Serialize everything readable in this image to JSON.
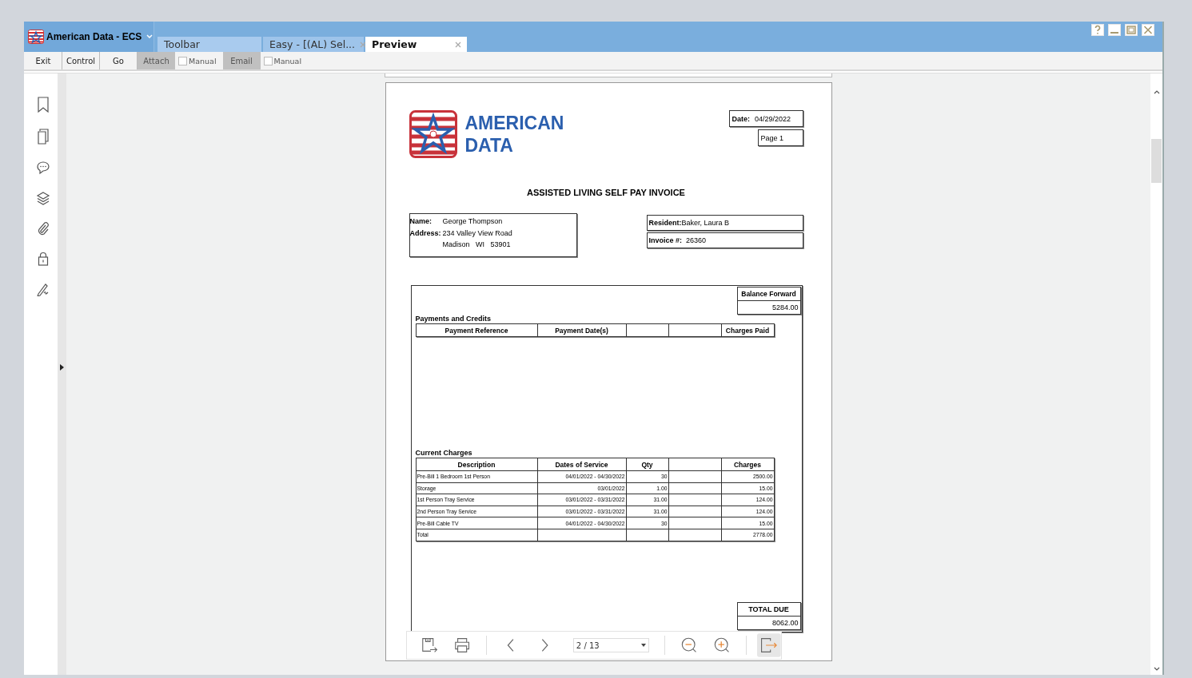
{
  "app": {
    "title": "American Data - ECS"
  },
  "tabs": [
    {
      "label": "Toolbar",
      "selected": false,
      "closable": false
    },
    {
      "label": "Easy - [(AL) Sel...",
      "selected": false,
      "closable": true
    },
    {
      "label": "Preview",
      "selected": true,
      "closable": true
    }
  ],
  "toolbar": [
    {
      "kind": "button",
      "label": "Exit",
      "disabled": false
    },
    {
      "kind": "button",
      "label": "Control",
      "disabled": false
    },
    {
      "kind": "button",
      "label": "Go",
      "disabled": false
    },
    {
      "kind": "button",
      "label": "Attach",
      "disabled": true
    },
    {
      "kind": "checkbox",
      "label": "Manual",
      "checked": false
    },
    {
      "kind": "button",
      "label": "Email",
      "disabled": true
    },
    {
      "kind": "checkbox",
      "label": "Manual",
      "checked": false
    }
  ],
  "invoice": {
    "logo_lines": [
      "AMERICAN",
      "DATA"
    ],
    "date_label": "Date:",
    "date": "04/29/2022",
    "page": "Page 1",
    "title": "ASSISTED LIVING SELF PAY INVOICE",
    "name_label": "Name:",
    "name": "George Thompson",
    "address_label": "Address:",
    "address_lines": [
      "234 Valley View Road",
      "Madison   WI   53901"
    ],
    "resident_label": "Resident:",
    "resident": "Baker, Laura B",
    "invoice_label": "Invoice #:",
    "invoice_number": "26360",
    "balance_label": "Balance Forward",
    "balance": "5284.00",
    "payments_title": "Payments and Credits",
    "payments_columns": [
      {
        "label": "Payment Reference"
      },
      {
        "label": "Payment Date(s)"
      },
      {},
      {},
      {
        "label": "Charges Paid"
      }
    ],
    "charges_title": "Current Charges",
    "charges_columns": [
      {
        "label": "Description"
      },
      {
        "label": "Dates of Service"
      },
      {
        "label": "Qty"
      },
      {},
      {
        "label": "Charges"
      }
    ],
    "charges_rows": [
      {
        "description": "Pre-Bill 1 Bedroom 1st Person",
        "dates": "04/01/2022 - 04/30/2022",
        "qty": "30",
        "charges": "2500.00"
      },
      {
        "description": "Storage",
        "dates": "03/01/2022",
        "qty": "1.00",
        "charges": "15.00"
      },
      {
        "description": "1st Person Tray Service",
        "dates": "03/01/2022 - 03/31/2022",
        "qty": "31.00",
        "charges": "124.00"
      },
      {
        "description": "2nd Person Tray Service",
        "dates": "03/01/2022 - 03/31/2022",
        "qty": "31.00",
        "charges": "124.00"
      },
      {
        "description": "Pre-Bill Cable TV",
        "dates": "04/01/2022 - 04/30/2022",
        "qty": "30",
        "charges": "15.00"
      },
      {
        "description": "Total",
        "charges": "2778.00"
      }
    ],
    "total_due_label": "TOTAL DUE",
    "total_due": "8062.00"
  },
  "viewer_toolbar": {
    "page_indicator": "2 / 13"
  }
}
